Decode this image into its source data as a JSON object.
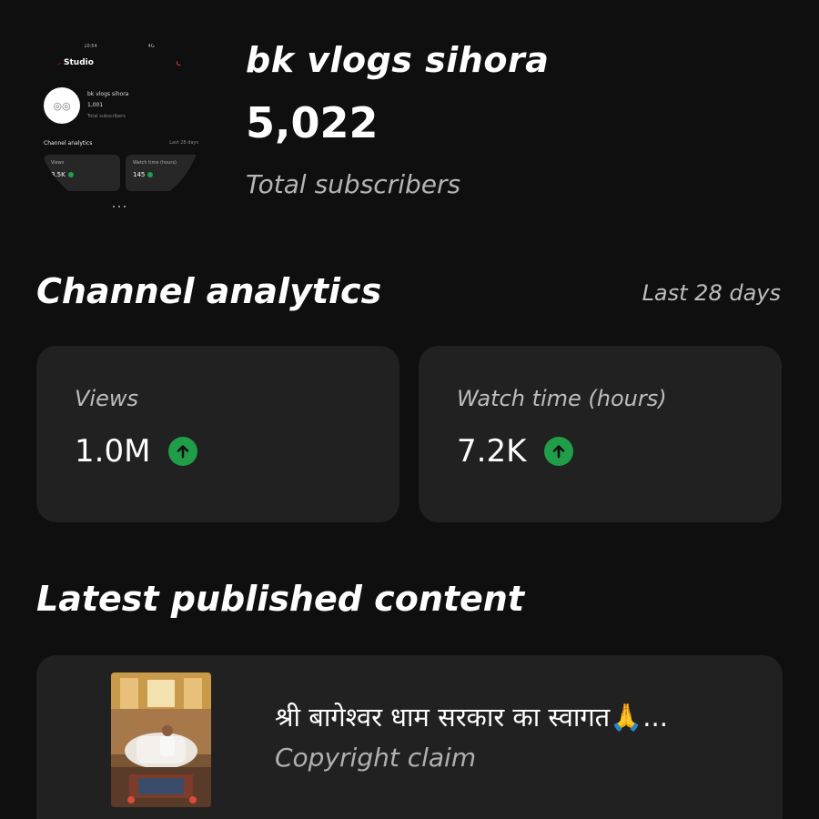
{
  "channel": {
    "name": "bk vlogs sihora",
    "subscriber_count": "5,022",
    "subscriber_label": "Total subscribers"
  },
  "avatar_preview": {
    "studio_label": "Studio",
    "channel_name": "bk vlogs sihora",
    "subscribers": "1,001",
    "subscribers_label": "Total subscribers",
    "analytics_label": "Channel analytics",
    "period_label": "Last 28 days",
    "card1_label": "Views",
    "card1_value": "3.5K",
    "card2_label": "Watch time (hours)",
    "card2_value": "145"
  },
  "analytics": {
    "title": "Channel analytics",
    "period": "Last 28 days",
    "views_label": "Views",
    "views_value": "1.0M",
    "watch_label": "Watch time (hours)",
    "watch_value": "7.2K",
    "trend_color": "#1f9d48"
  },
  "latest": {
    "title": "Latest published content",
    "video_title": "श्री बागेश्वर धाम सरकार का स्वागत🙏...",
    "video_status": "Copyright claim"
  },
  "icons": {
    "trend": "arrow-up-icon"
  }
}
